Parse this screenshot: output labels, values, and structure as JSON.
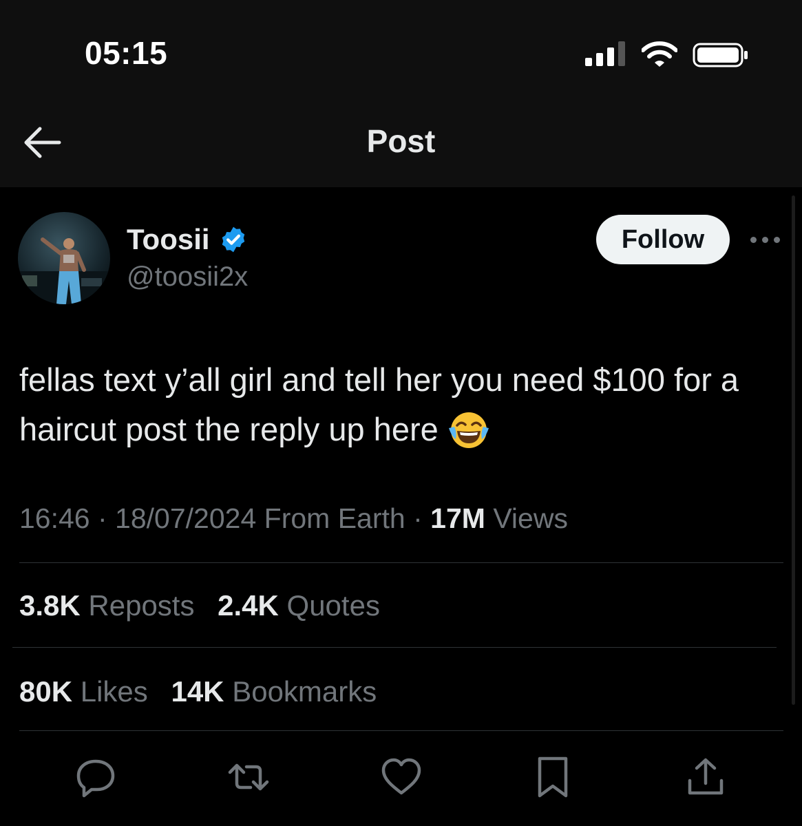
{
  "status_bar": {
    "time": "05:15"
  },
  "header": {
    "title": "Post"
  },
  "author": {
    "name": "Toosii",
    "handle": "@toosii2x",
    "verified": true
  },
  "follow_label": "Follow",
  "post": {
    "text": "fellas text y’all girl and tell her you need $100 for a haircut post the reply up here",
    "emoji": "😂"
  },
  "meta": {
    "time": "16:46",
    "date": "18/07/2024",
    "location": "From Earth",
    "views_count": "17M",
    "views_label": "Views"
  },
  "stats": [
    {
      "count": "3.8K",
      "label": "Reposts"
    },
    {
      "count": "2.4K",
      "label": "Quotes"
    },
    {
      "count": "80K",
      "label": "Likes"
    },
    {
      "count": "14K",
      "label": "Bookmarks"
    }
  ],
  "actions": [
    "reply-icon",
    "repost-icon",
    "like-icon",
    "bookmark-icon",
    "share-icon"
  ],
  "colors": {
    "background": "#000000",
    "text": "#e7e9ea",
    "muted": "#71767b",
    "verified": "#1d9bf0",
    "divider": "#2f3336"
  }
}
